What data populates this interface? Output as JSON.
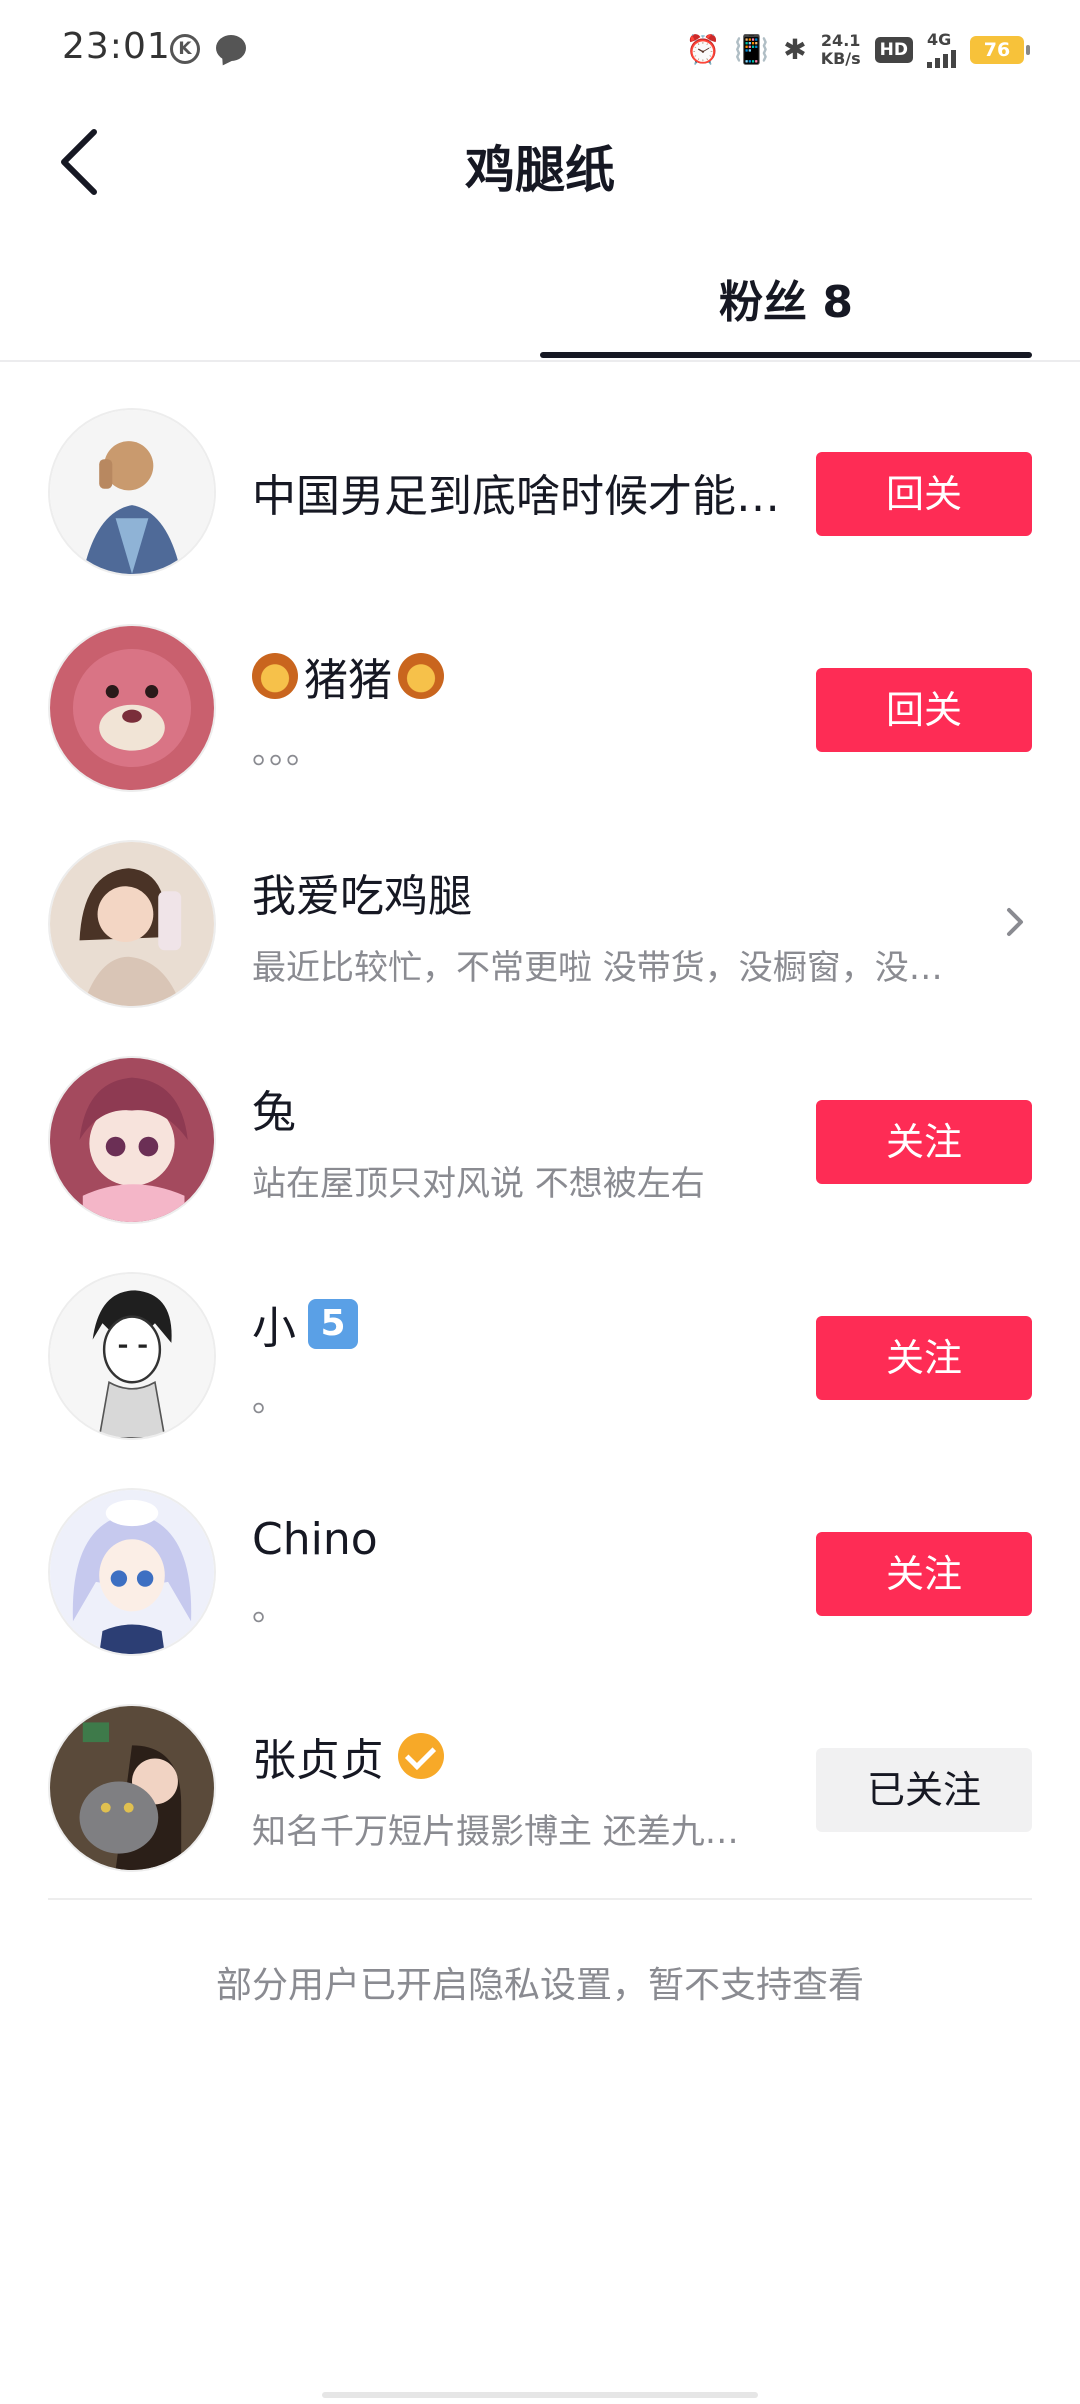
{
  "status_bar": {
    "time": "23:01",
    "speed_top": "24.1",
    "speed_bottom": "KB/s",
    "hd": "HD",
    "network": "4G",
    "battery": "76"
  },
  "header": {
    "title": "鸡腿纸"
  },
  "tabs": {
    "fans_label": "粉丝 8"
  },
  "fans": [
    {
      "name": "中国男足到底啥时候才能…",
      "sub": "",
      "action": "回关",
      "state": "follow-back"
    },
    {
      "name": "猪猪",
      "sub": "。。。",
      "action": "回关",
      "state": "follow-back",
      "emoji": "lion"
    },
    {
      "name": "我爱吃鸡腿",
      "sub": "最近比较忙，不常更啦 没带货，没橱窗，没…",
      "action": "",
      "state": "self"
    },
    {
      "name": "兔",
      "sub": "站在屋顶只对风说 不想被左右",
      "action": "关注",
      "state": "follow"
    },
    {
      "name": "小",
      "sub": "。",
      "action": "关注",
      "state": "follow",
      "emoji": "keycap-5"
    },
    {
      "name": "Chino",
      "sub": "。",
      "action": "关注",
      "state": "follow"
    },
    {
      "name": "张贞贞",
      "sub": "知名千万短片摄影博主 还差九…",
      "action": "已关注",
      "state": "followed",
      "verified": true
    }
  ],
  "footer": {
    "privacy_note": "部分用户已开启隐私设置，暂不支持查看"
  },
  "colors": {
    "primary_button": "#fe2c55",
    "followed_button": "#f1f1f2",
    "verified_badge": "#f7a928",
    "text_primary": "#161823",
    "text_secondary": "#8a8b91"
  }
}
